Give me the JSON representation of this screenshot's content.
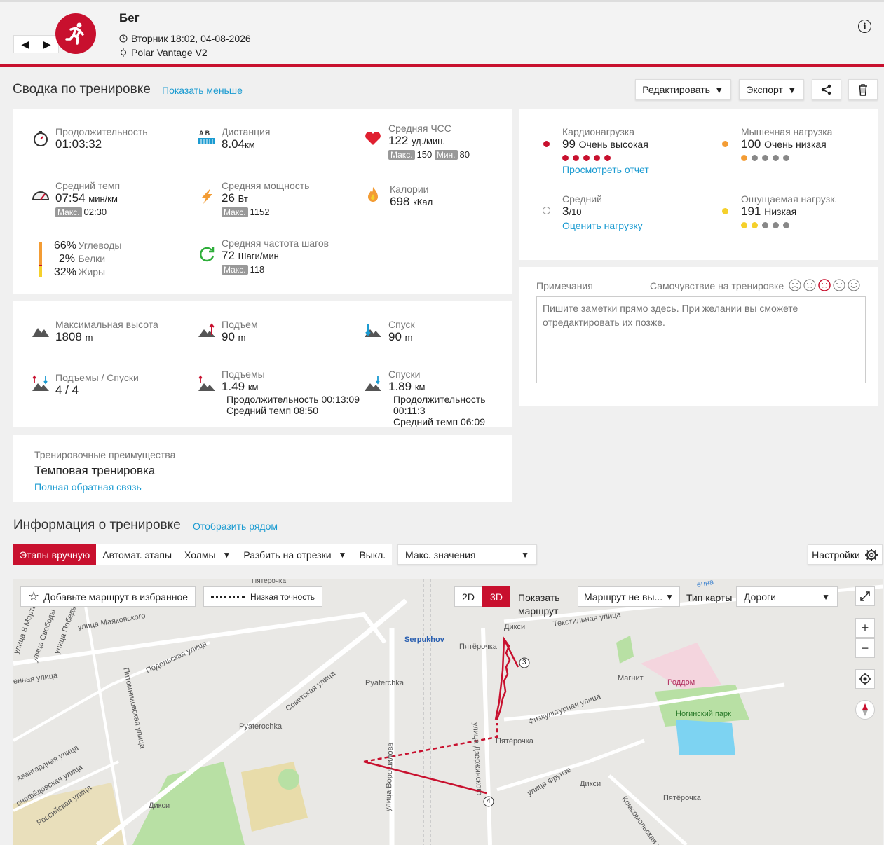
{
  "header": {
    "nav_prev": "◀",
    "nav_next": "▶",
    "title": "Бег",
    "datetime": "Вторник 18:02, 04-08-2026",
    "device": "Polar Vantage V2",
    "info": "i"
  },
  "summary": {
    "title": "Сводка по тренировке",
    "toggle": "Показать меньше",
    "edit_label": "Редактировать",
    "export_label": "Экспорт"
  },
  "metrics": {
    "duration": {
      "label": "Продолжительность",
      "value": "01:03:32"
    },
    "distance": {
      "label": "Дистанция",
      "value": "8.04",
      "unit": "км",
      "icon_text": "A B"
    },
    "hr": {
      "label": "Средняя ЧСС",
      "value": "122",
      "unit": "уд./мин.",
      "max_tag": "Макс.",
      "max": "150",
      "min_tag": "Мин.",
      "min": "80"
    },
    "pace": {
      "label": "Средний темп",
      "value": "07:54",
      "unit": "мин/км",
      "max_tag": "Макс.",
      "max": "02:30"
    },
    "power": {
      "label": "Средняя мощность",
      "value": "26",
      "unit": "Вт",
      "max_tag": "Макс.",
      "max": "1152"
    },
    "calories": {
      "label": "Калории",
      "value": "698",
      "unit": "кКал"
    },
    "carbs": {
      "value": "66%",
      "label": "Углеводы"
    },
    "protein": {
      "value": "2%",
      "label": "Белки"
    },
    "fat": {
      "value": "32%",
      "label": "Жиры"
    },
    "cadence": {
      "label": "Средняя частота шагов",
      "value": "72",
      "unit": "Шаги/мин",
      "max_tag": "Макс.",
      "max": "118"
    }
  },
  "load": {
    "cardio": {
      "label": "Кардионагрузка",
      "value": "99",
      "desc": "Очень высокая",
      "link": "Просмотреть отчет",
      "level": 5
    },
    "muscle": {
      "label": "Мышечная нагрузка",
      "value": "100",
      "desc": "Очень низкая",
      "level": 1
    },
    "rpe": {
      "label": "Средний",
      "value": "3",
      "suffix": "/10",
      "link": "Оценить нагрузку"
    },
    "perceived": {
      "label": "Ощущаемая нагрузк.",
      "value": "191",
      "desc": "Низкая",
      "level": 2
    }
  },
  "colors": {
    "brand": "#c8102e",
    "link": "#1b9bd1",
    "muscle": "#f39c34",
    "perceived": "#f5d02b",
    "dot_inactive": "#888888"
  },
  "notes": {
    "label": "Примечания",
    "feeling_label": "Самочувствие на тренировке",
    "placeholder": "Пишите заметки прямо здесь. При желании вы сможете отредактировать их позже."
  },
  "elevation": {
    "max_alt": {
      "label": "Максимальная высота",
      "value": "1808",
      "unit": "m"
    },
    "ascent": {
      "label": "Подъем",
      "value": "90",
      "unit": "m"
    },
    "descent": {
      "label": "Спуск",
      "value": "90",
      "unit": "m"
    },
    "ups_downs": {
      "label": "Подъемы / Спуски",
      "value": "4 / 4"
    },
    "uphills": {
      "label": "Подъемы",
      "value": "1.49",
      "unit": "км",
      "duration": "Продолжительность 00:13:09",
      "pace": "Средний темп 08:50"
    },
    "downhills": {
      "label": "Спуски",
      "value": "1.89",
      "unit": "км",
      "duration": "Продолжительность 00:11:3",
      "pace": "Средний темп 06:09"
    }
  },
  "benefit": {
    "label": "Тренировочные преимущества",
    "value": "Темповая тренировка",
    "link": "Полная обратная связь"
  },
  "info_section": {
    "title": "Информация о тренировке",
    "side_link": "Отобразить рядом"
  },
  "tabs": {
    "manual": "Этапы вручную",
    "auto": "Автомат. этапы",
    "hills": "Холмы",
    "split": "Разбить на отрезки",
    "off": "Выкл.",
    "maxvals": "Макс. значения",
    "settings": "Настройки"
  },
  "map": {
    "fav": "Добавьте маршрут в избранное",
    "accuracy": "Низкая точность",
    "btn_2d": "2D",
    "btn_3d": "3D",
    "show_route_1": "Показать",
    "show_route_2": "маршрут",
    "route_select": "Маршрут не вы...",
    "map_type_label": "Тип карты",
    "map_type": "Дороги",
    "labels": {
      "serpukhov": "Serpukhov",
      "pyaterochka1": "Пятёрочка",
      "pyaterochka2": "Пятёрочка",
      "pyaterochka3": "Пятёрочка",
      "pyaterochka_top": "Пятёрочка",
      "pyaterochka_en1": "Pyaterchka",
      "pyaterochka_en2": "Pyaterochka",
      "dixy1": "Дикси",
      "dixy2": "Дикси",
      "dixy3": "Дикси",
      "magnit": "Магнит",
      "roddom": "Роддом",
      "park": "Ногинский парк",
      "st_mayakovskogo": "улица Маяковского",
      "st_podolskaya": "Подольская улица",
      "st_sovetskaya": "Советская улица",
      "st_pitomnik": "Питомниковская улица",
      "st_voroshilova": "улица Ворошилова",
      "st_dzerzhinskogo": "улица Дзержинского",
      "st_fizkult": "Физкультурная улица",
      "st_frunze": "улица Фрунзе",
      "st_komsomol": "Комсомольская ул",
      "st_textile": "Текстильная улица",
      "st_avangard": "Авангардная улица",
      "st_nefed": "онефёдовская улица",
      "st_russ": "Российская улица",
      "st_8marta": "улица 8 Марта",
      "st_svobody": "улица Свободы",
      "st_pobedy": "улица Победы",
      "st_ennaya": "енная улица",
      "st_kenna": "енна",
      "marker_3": "3",
      "marker_4": "4"
    }
  }
}
